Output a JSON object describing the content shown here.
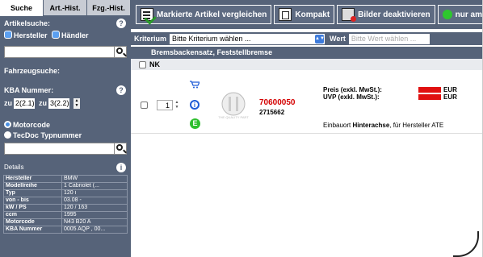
{
  "sidebar": {
    "tabs": [
      "Suche",
      "Art.-Hist.",
      "Fzg.-Hist."
    ],
    "artikelsuche": {
      "label": "Artikelsuche:",
      "opt_hersteller": "Hersteller",
      "opt_haendler": "Händler"
    },
    "fahrzeugsuche": "Fahrzeugsuche:",
    "kba": {
      "label": "KBA Nummer:",
      "zu1": "zu",
      "val1": "2(2.1)",
      "zu2": "zu",
      "val2": "3(2.2)"
    },
    "motorcode": "Motorcode",
    "tecdoc": "TecDoc Typnummer",
    "details": {
      "label": "Details",
      "rows": [
        [
          "Hersteller",
          "BMW"
        ],
        [
          "Modellreihe",
          "1 Cabriolet (..."
        ],
        [
          "Typ",
          "120 i"
        ],
        [
          "von - bis",
          "03.08 -"
        ],
        [
          "kW / PS",
          "120 / 163"
        ],
        [
          "ccm",
          "1995"
        ],
        [
          "Motorcode",
          "N43 B20 A"
        ],
        [
          "KBA Nummer",
          "0005 AQP , 00..."
        ]
      ]
    }
  },
  "toolbar": {
    "compare": "Markierte Artikel vergleichen",
    "compact": "Kompakt",
    "images": "Bilder deaktivieren",
    "stock": "nur am La"
  },
  "filter": {
    "kriterium_label": "Kriterium",
    "kriterium_value": "Bitte Kriterium wählen ...",
    "wert_label": "Wert",
    "wert_placeholder": "Bitte Wert wählen ..."
  },
  "category": "Bremsbackensatz, Feststellbremse",
  "group": "NK",
  "article": {
    "qty": "1",
    "number": "70600050",
    "number2": "2715662",
    "logo_text": "THE QUALITY PART",
    "price_label": "Preis (exkl. MwSt.):",
    "uvp_label": "UVP (exkl. MwSt.):",
    "currency": "EUR",
    "note_pre": "Einbauort ",
    "note_bold": "Hinterachse",
    "note_post": ", für Hersteller ATE"
  }
}
